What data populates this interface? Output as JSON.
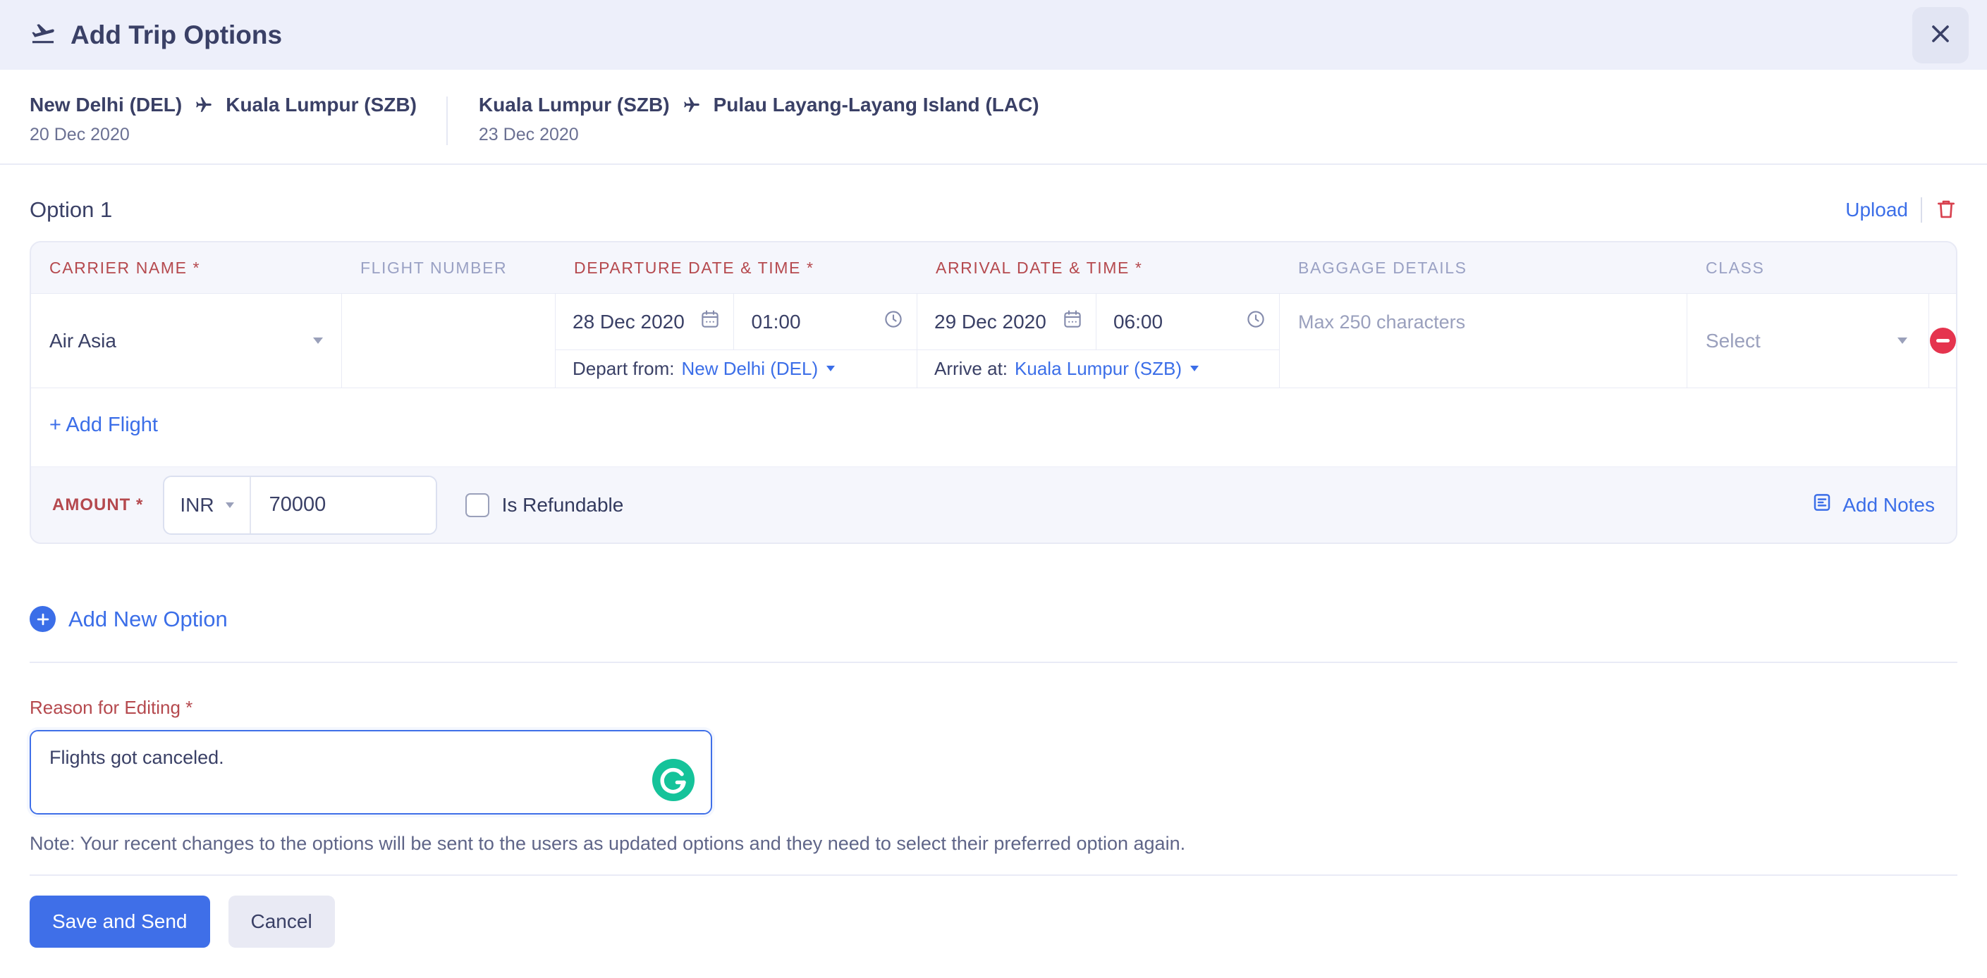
{
  "header": {
    "title": "Add Trip Options"
  },
  "segments": [
    {
      "from": "New Delhi (DEL)",
      "to": "Kuala Lumpur (SZB)",
      "date": "20 Dec 2020"
    },
    {
      "from": "Kuala Lumpur (SZB)",
      "to": "Pulau Layang-Layang Island (LAC)",
      "date": "23 Dec 2020"
    }
  ],
  "option": {
    "title": "Option 1",
    "upload_label": "Upload",
    "columns": [
      "CARRIER NAME *",
      "FLIGHT NUMBER",
      "DEPARTURE DATE & TIME *",
      "ARRIVAL DATE & TIME *",
      "BAGGAGE DETAILS",
      "CLASS"
    ],
    "flight": {
      "carrier": "Air Asia",
      "flight_number": "",
      "departure_date": "28 Dec 2020",
      "departure_time": "01:00",
      "arrival_date": "29 Dec 2020",
      "arrival_time": "06:00",
      "baggage_placeholder": "Max 250 characters",
      "class_placeholder": "Select",
      "depart_from_label": "Depart from:",
      "depart_from_value": "New Delhi (DEL)",
      "arrive_at_label": "Arrive at:",
      "arrive_at_value": "Kuala Lumpur (SZB)"
    },
    "add_flight_label": "+ Add Flight",
    "amount": {
      "label": "AMOUNT *",
      "currency": "INR",
      "value": "70000",
      "refundable_label": "Is Refundable",
      "add_notes_label": "Add Notes"
    }
  },
  "add_new_option_label": "Add New Option",
  "reason": {
    "label": "Reason for Editing *",
    "value": "Flights got canceled."
  },
  "note": "Note: Your recent changes to the options will be sent to the users as updated options and they need to select their preferred option again.",
  "footer": {
    "save_label": "Save and Send",
    "cancel_label": "Cancel"
  },
  "colors": {
    "accent_blue": "#3b6ee8",
    "required_red": "#b5494e",
    "danger_red": "#e5344e",
    "grammarly_green": "#15c39a",
    "dark_text": "#3a4066",
    "header_bg": "#edeffa",
    "card_bg": "#f5f6fc"
  }
}
